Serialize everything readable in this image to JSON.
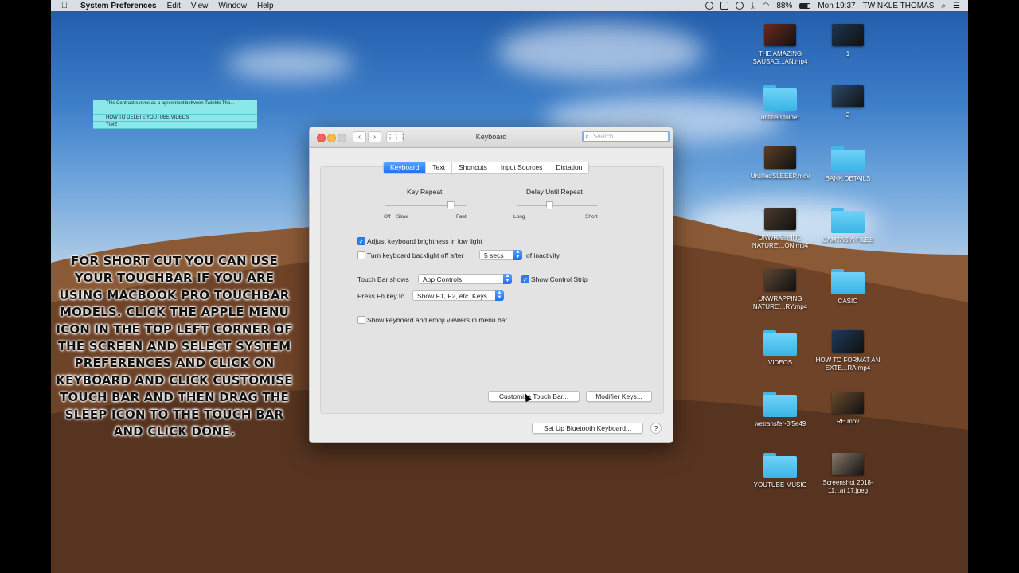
{
  "menubar": {
    "app_name": "System Preferences",
    "items": [
      "Edit",
      "View",
      "Window",
      "Help"
    ],
    "battery": "88%",
    "clock": "Mon 19:37",
    "user": "TWINKLE THOMAS"
  },
  "sticky_note": {
    "lines": [
      "This Contract serves as a agreement between Twinkle Tho...",
      "",
      "HOW TO DELETE YOUTUBE VIDEOS",
      "TIME"
    ]
  },
  "overlay_text": "FOR SHORT CUT YOU CAN USE YOUR TOUCHBAR IF YOU ARE USING MACBOOK PRO TOUCHBAR MODELS. CLICK THE APPLE MENU ICON IN THE TOP LEFT CORNER OF THE SCREEN AND SELECT SYSTEM PREFERENCES AND CLICK ON KEYBOARD AND CLICK CUSTOMISE TOUCH BAR AND THEN DRAG THE SLEEP ICON TO THE TOUCH BAR AND CLICK DONE.",
  "window": {
    "title": "Keyboard",
    "search_placeholder": "Search",
    "tabs": [
      "Keyboard",
      "Text",
      "Shortcuts",
      "Input Sources",
      "Dictation"
    ],
    "active_tab": "Keyboard",
    "key_repeat": {
      "label": "Key Repeat",
      "left": "Off",
      "left2": "Slow",
      "right": "Fast",
      "value": 0.8
    },
    "delay_repeat": {
      "label": "Delay Until Repeat",
      "left": "Long",
      "right": "Short",
      "value": 0.4
    },
    "adjust_brightness": {
      "label": "Adjust keyboard brightness in low light",
      "checked": true
    },
    "backlight_off": {
      "label": "Turn keyboard backlight off after",
      "value": "5 secs",
      "suffix": "of inactivity",
      "checked": false
    },
    "touch_bar_shows": {
      "label": "Touch Bar shows",
      "value": "App Controls"
    },
    "show_control_strip": {
      "label": "Show Control Strip",
      "checked": true
    },
    "fn_key": {
      "label": "Press Fn key to",
      "value": "Show F1, F2, etc. Keys"
    },
    "emoji_viewers": {
      "label": "Show keyboard and emoji viewers in menu bar",
      "checked": false
    },
    "customise_button": "Customise Touch Bar...",
    "modifier_button": "Modifier Keys...",
    "bluetooth_button": "Set Up Bluetooth Keyboard...",
    "help_label": "?"
  },
  "desktop": {
    "items": [
      {
        "label": "THE AMAZING SAUSAG...AN.mp4",
        "kind": "video",
        "color": "#6b2a20"
      },
      {
        "label": "1",
        "kind": "video",
        "color": "#1c3550"
      },
      {
        "label": "untitled folder",
        "kind": "folder"
      },
      {
        "label": "2",
        "kind": "video",
        "color": "#2b4a6a"
      },
      {
        "label": "UntitledSLEEEP.mov",
        "kind": "video",
        "color": "#5a3e26"
      },
      {
        "label": "BANK DETAILS",
        "kind": "folder"
      },
      {
        "label": "UNWRAPPING NATURE'...ON.mp4",
        "kind": "video",
        "color": "#4a3b2e"
      },
      {
        "label": "CAMTASIA FILES",
        "kind": "folder"
      },
      {
        "label": "UNWRAPPING NATURE'...RY.mp4",
        "kind": "video",
        "color": "#5b4636"
      },
      {
        "label": "CASIO",
        "kind": "folder"
      },
      {
        "label": "VIDEOS",
        "kind": "folder"
      },
      {
        "label": "HOW TO FORMAT AN EXTE...RA.mp4",
        "kind": "video",
        "color": "#1f3a5a"
      },
      {
        "label": "wetransfer-3f5e49",
        "kind": "folder"
      },
      {
        "label": "RE.mov",
        "kind": "video",
        "color": "#6a4a2c"
      },
      {
        "label": "YOUTUBE MUSIC",
        "kind": "folder"
      },
      {
        "label": "Screenshot 2018-11...at 17.jpeg",
        "kind": "video",
        "color": "#8a7a6a"
      }
    ]
  }
}
